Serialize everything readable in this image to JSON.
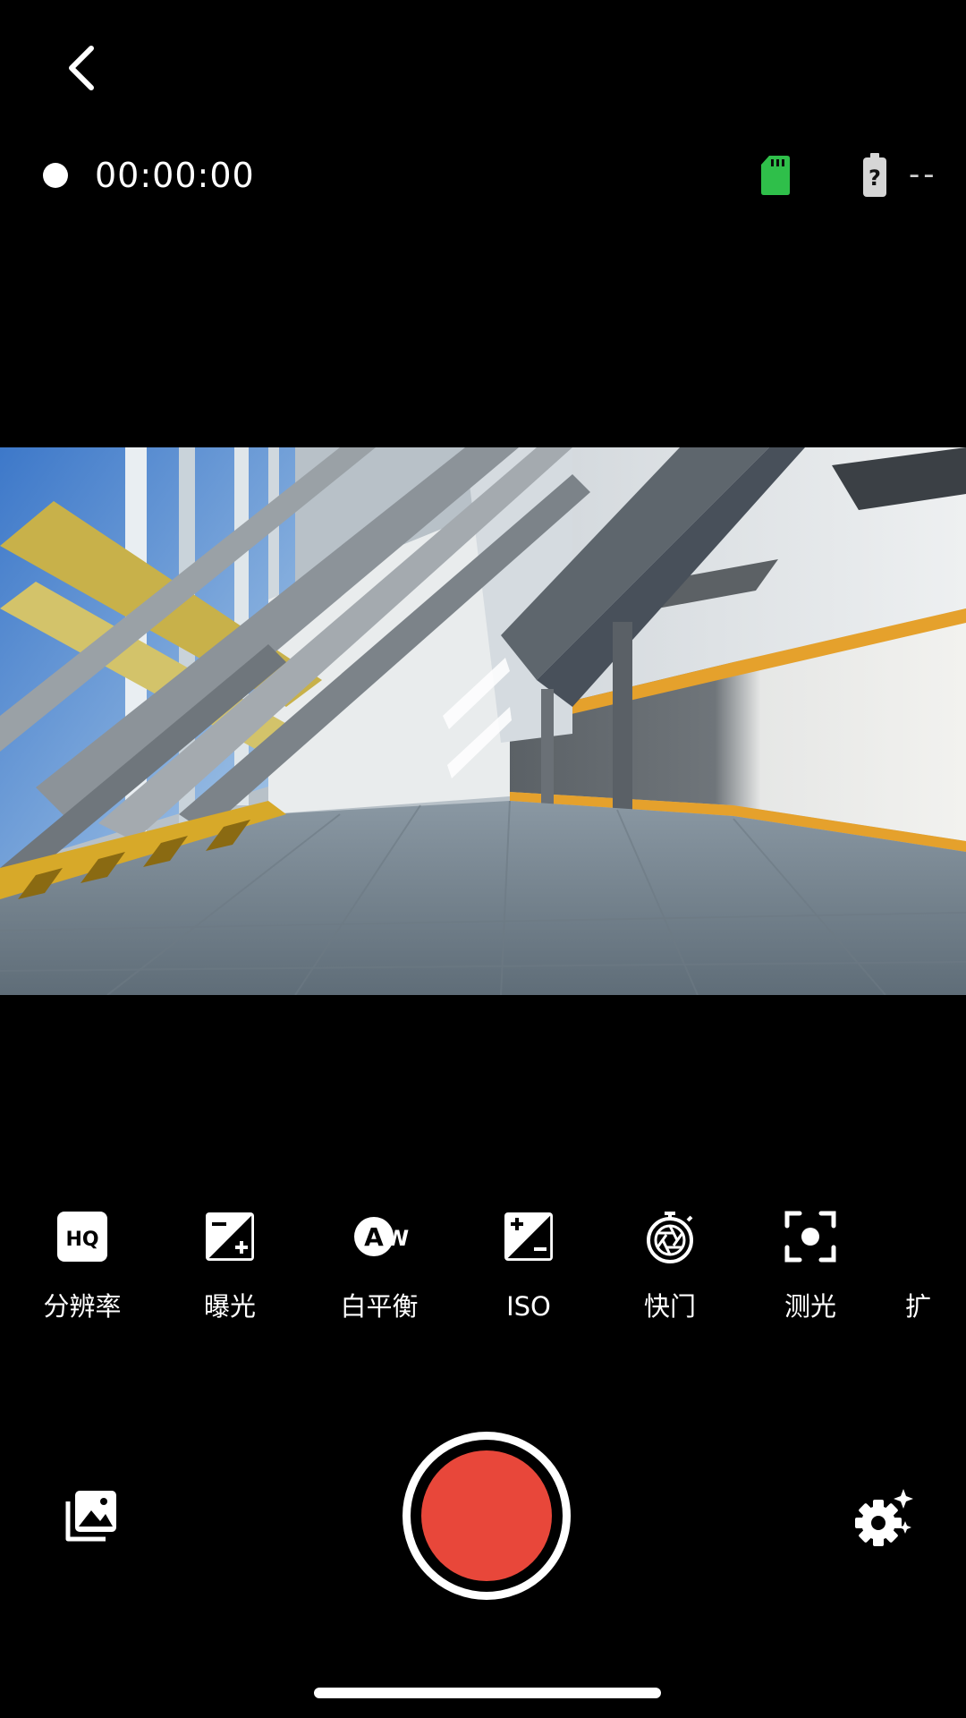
{
  "header": {
    "back_icon": "chevron-left-icon"
  },
  "status": {
    "recording_dot_color": "#ffffff",
    "timer": "00:00:00",
    "sd_card_icon": "sd-card-icon",
    "sd_card_color": "#2fbf4a",
    "battery_icon": "battery-unknown-icon",
    "battery_text": "--"
  },
  "settings": {
    "items": [
      {
        "icon": "hq-resolution-icon",
        "label": "分辨率"
      },
      {
        "icon": "exposure-icon",
        "label": "曝光"
      },
      {
        "icon": "auto-white-balance-icon",
        "label": "白平衡"
      },
      {
        "icon": "iso-icon",
        "label": "ISO"
      },
      {
        "icon": "shutter-timer-icon",
        "label": "快门"
      },
      {
        "icon": "metering-icon",
        "label": "测光"
      },
      {
        "icon": "extra-setting-icon",
        "label": "扩"
      }
    ]
  },
  "controls": {
    "gallery_icon": "gallery-icon",
    "record_button_color": "#e8473a",
    "settings_icon": "gear-sparkle-icon"
  }
}
